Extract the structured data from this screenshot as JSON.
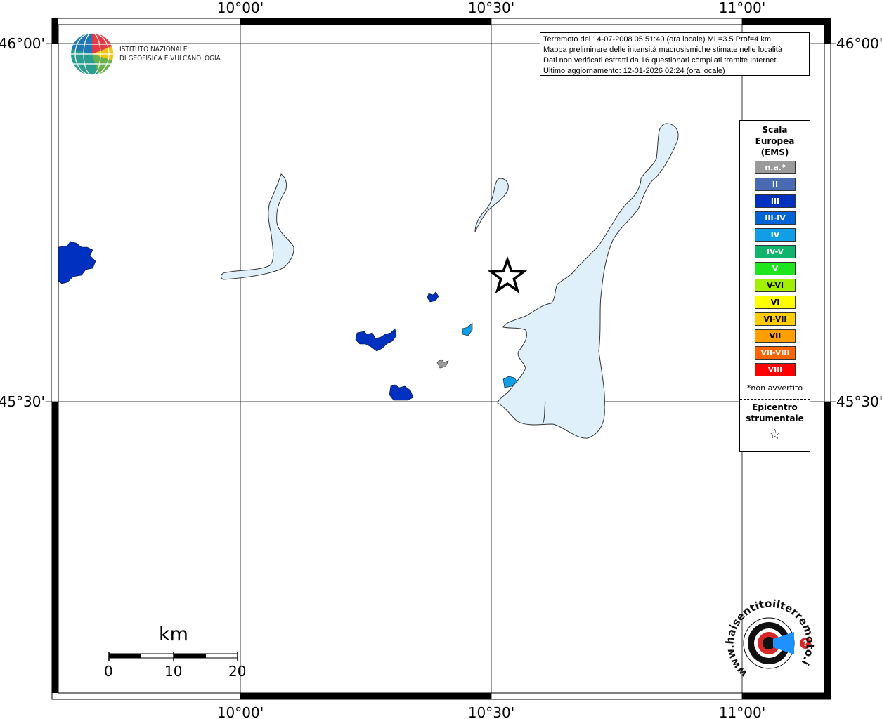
{
  "axes": {
    "top_labels": [
      "10°00'",
      "10°30'",
      "11°00'"
    ],
    "bottom_labels": [
      "10°00'",
      "10°30'",
      "11°00'"
    ],
    "left_labels": [
      "46°00'",
      "45°30'"
    ],
    "right_labels": [
      "46°00'",
      "45°30'"
    ]
  },
  "logo": {
    "line1": "ISTITUTO NAZIONALE",
    "line2": "DI GEOFISICA E VULCANOLOGIA"
  },
  "info": {
    "line1": "Terremoto del 14-07-2008 05:51:40 (ora locale) ML=3.5 Prof=4 km",
    "line2": "Mappa preliminare delle intensità macrosismiche stimate nelle località",
    "line3": "Dati non verificati estratti da 16 questionari compilati tramite Internet.",
    "line4": "Ultimo aggiornamento: 12-01-2026 02:24 (ora locale)"
  },
  "legend": {
    "title_line1": "Scala",
    "title_line2": "Europea",
    "title_line3": "(EMS)",
    "items": [
      {
        "label": "n.a.*",
        "color": "#9a9a9a"
      },
      {
        "label": "II",
        "color": "#4a6ab4"
      },
      {
        "label": "III",
        "color": "#0030c0"
      },
      {
        "label": "III-IV",
        "color": "#0064d6"
      },
      {
        "label": "IV",
        "color": "#109ee6"
      },
      {
        "label": "IV-V",
        "color": "#10b46c"
      },
      {
        "label": "V",
        "color": "#1ee61e"
      },
      {
        "label": "V-VI",
        "color": "#a2f000"
      },
      {
        "label": "VI",
        "color": "#ffff00"
      },
      {
        "label": "VI-VII",
        "color": "#ffcc00"
      },
      {
        "label": "VII",
        "color": "#ffa000"
      },
      {
        "label": "VII-VIII",
        "color": "#ff6400"
      },
      {
        "label": "VIII",
        "color": "#ff0000"
      }
    ],
    "na_note": "*non avvertito",
    "epi_line1": "Epicentro",
    "epi_line2": "strumentale",
    "epi_symbol": "☆"
  },
  "scale_bar": {
    "unit": "km",
    "ticks": [
      "0",
      "10",
      "20"
    ]
  },
  "colors": {
    "lake": "#dff0fa",
    "intensity_III": "#0030c0",
    "intensity_IV": "#109ee6",
    "not_available": "#9a9a9a"
  },
  "badge": {
    "text": "www.haisentitoilterremoto.it"
  }
}
